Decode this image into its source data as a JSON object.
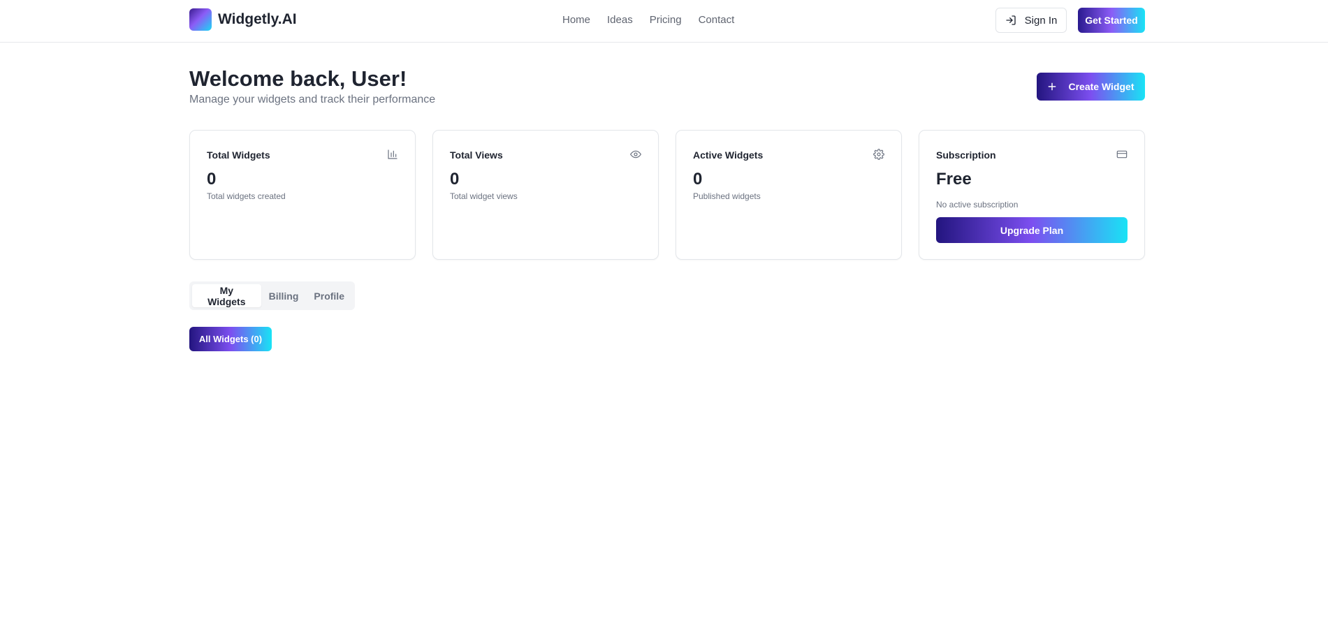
{
  "brand": {
    "name": "Widgetly.AI"
  },
  "nav": {
    "items": [
      "Home",
      "Ideas",
      "Pricing",
      "Contact"
    ]
  },
  "header": {
    "sign_in": "Sign In",
    "get_started": "Get Started"
  },
  "welcome": {
    "title": "Welcome back, User!",
    "subtitle": "Manage your widgets and track their performance",
    "create_button": "Create Widget"
  },
  "stats": [
    {
      "title": "Total Widgets",
      "value": "0",
      "note": "Total widgets created",
      "icon": "bar-chart-icon"
    },
    {
      "title": "Total Views",
      "value": "0",
      "note": "Total widget views",
      "icon": "eye-icon"
    },
    {
      "title": "Active Widgets",
      "value": "0",
      "note": "Published widgets",
      "icon": "gear-icon"
    },
    {
      "title": "Subscription",
      "value": "Free",
      "note": "No active subscription",
      "icon": "credit-card-icon",
      "button": "Upgrade Plan"
    }
  ],
  "tabs": [
    {
      "label": "My Widgets",
      "active": true
    },
    {
      "label": "Billing",
      "active": false
    },
    {
      "label": "Profile",
      "active": false
    }
  ],
  "filter": {
    "label": "All Widgets (0)"
  },
  "colors": {
    "gradient_start": "#23157f",
    "gradient_mid": "#7c4ff0",
    "gradient_end": "#19e3f5",
    "text": "#1f2430",
    "muted": "#6b7280"
  }
}
